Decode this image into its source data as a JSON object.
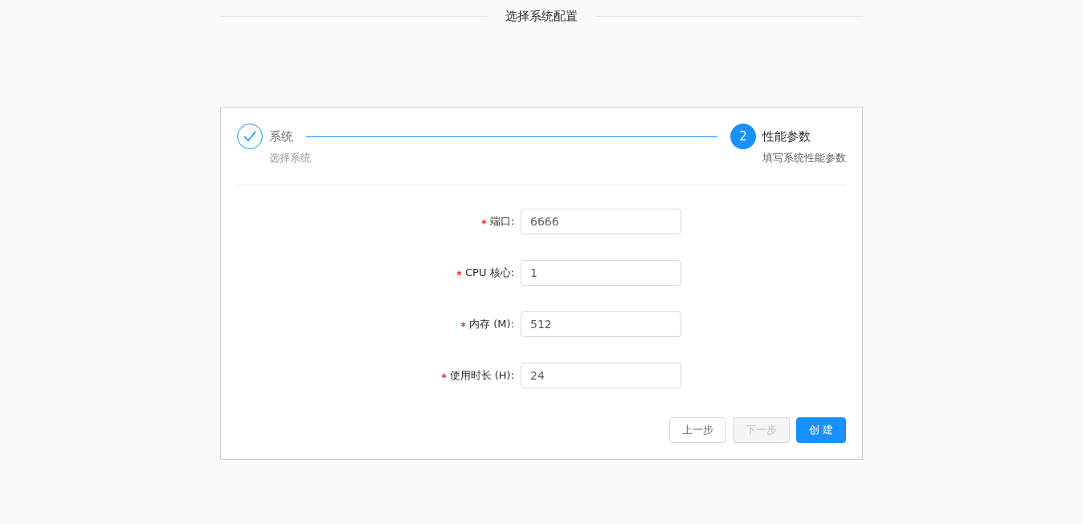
{
  "divider": {
    "title": "选择系统配置"
  },
  "steps": [
    {
      "title": "系统",
      "description": "选择系统",
      "finished": true,
      "active": false
    },
    {
      "number": "2",
      "title": "性能参数",
      "description": "填写系统性能参数",
      "finished": false,
      "active": true
    }
  ],
  "form": {
    "fields": [
      {
        "label": "端口:",
        "required": true,
        "value": "6666"
      },
      {
        "label": "CPU 核心:",
        "required": true,
        "value": "1"
      },
      {
        "label": "内存 (M):",
        "required": true,
        "value": "512"
      },
      {
        "label": "使用时长 (H):",
        "required": true,
        "value": "24"
      }
    ]
  },
  "buttons": [
    {
      "label": "上一步",
      "kind": "default",
      "disabled": false
    },
    {
      "label": "下一步",
      "kind": "default",
      "disabled": true
    },
    {
      "label": "创 建",
      "kind": "primary",
      "disabled": false
    }
  ]
}
